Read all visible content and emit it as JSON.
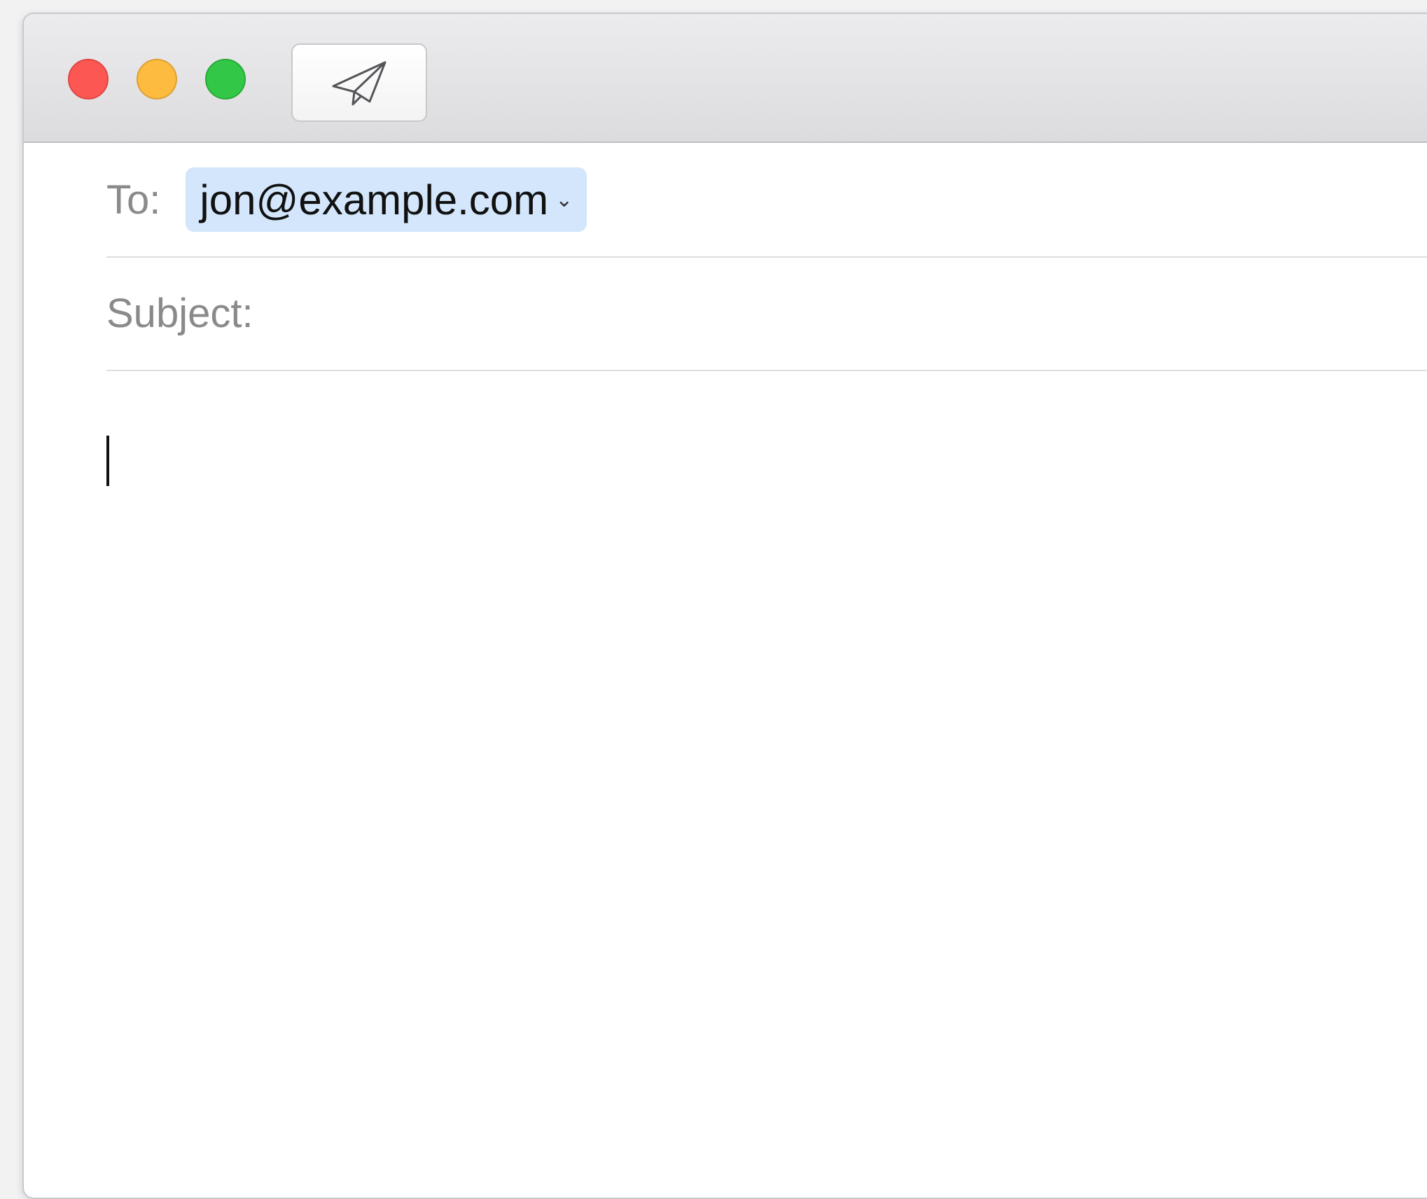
{
  "window": {
    "controls": {
      "close": "close-icon",
      "minimize": "minimize-icon",
      "zoom": "zoom-icon"
    },
    "toolbar": {
      "send_icon": "paper-plane-icon"
    }
  },
  "compose": {
    "to_label": "To:",
    "recipient": "jon@example.com",
    "recipient_chevron": "⌄",
    "subject_label": "Subject:",
    "subject_value": "",
    "body_text": ""
  },
  "colors": {
    "close": "#fc5753",
    "minimize": "#fdbc40",
    "zoom": "#33c748",
    "recipient_token": "#d3e6fb"
  }
}
